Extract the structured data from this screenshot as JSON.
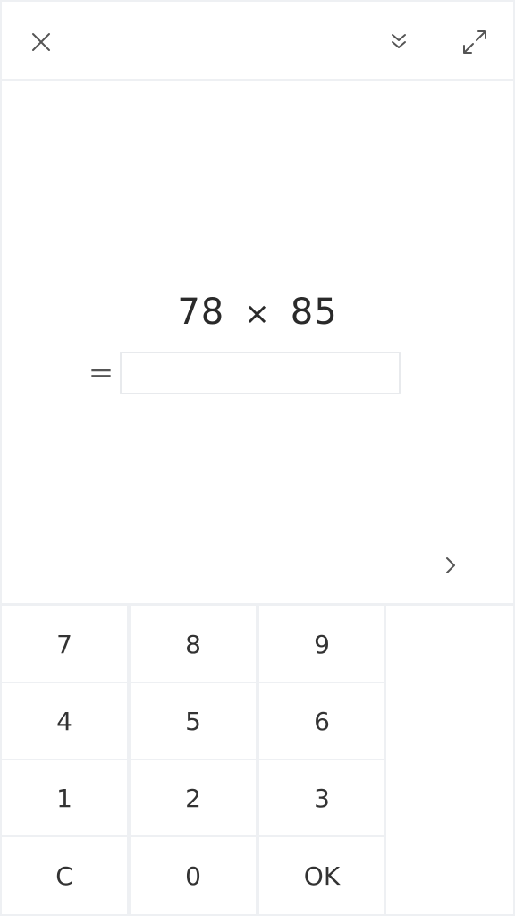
{
  "toolbar": {
    "close_icon": "close-icon",
    "collapse_icon": "double-chevron-down-icon",
    "expand_icon": "expand-arrows-icon"
  },
  "problem": {
    "operand_a": "78",
    "operator": "×",
    "operand_b": "85",
    "equals": "="
  },
  "answer": {
    "value": "",
    "placeholder": ""
  },
  "next_icon": "chevron-right-icon",
  "keypad": {
    "k7": "7",
    "k8": "8",
    "k9": "9",
    "k4": "4",
    "k5": "5",
    "k6": "6",
    "k1": "1",
    "k2": "2",
    "k3": "3",
    "clear": "C",
    "k0": "0",
    "ok": "OK"
  }
}
